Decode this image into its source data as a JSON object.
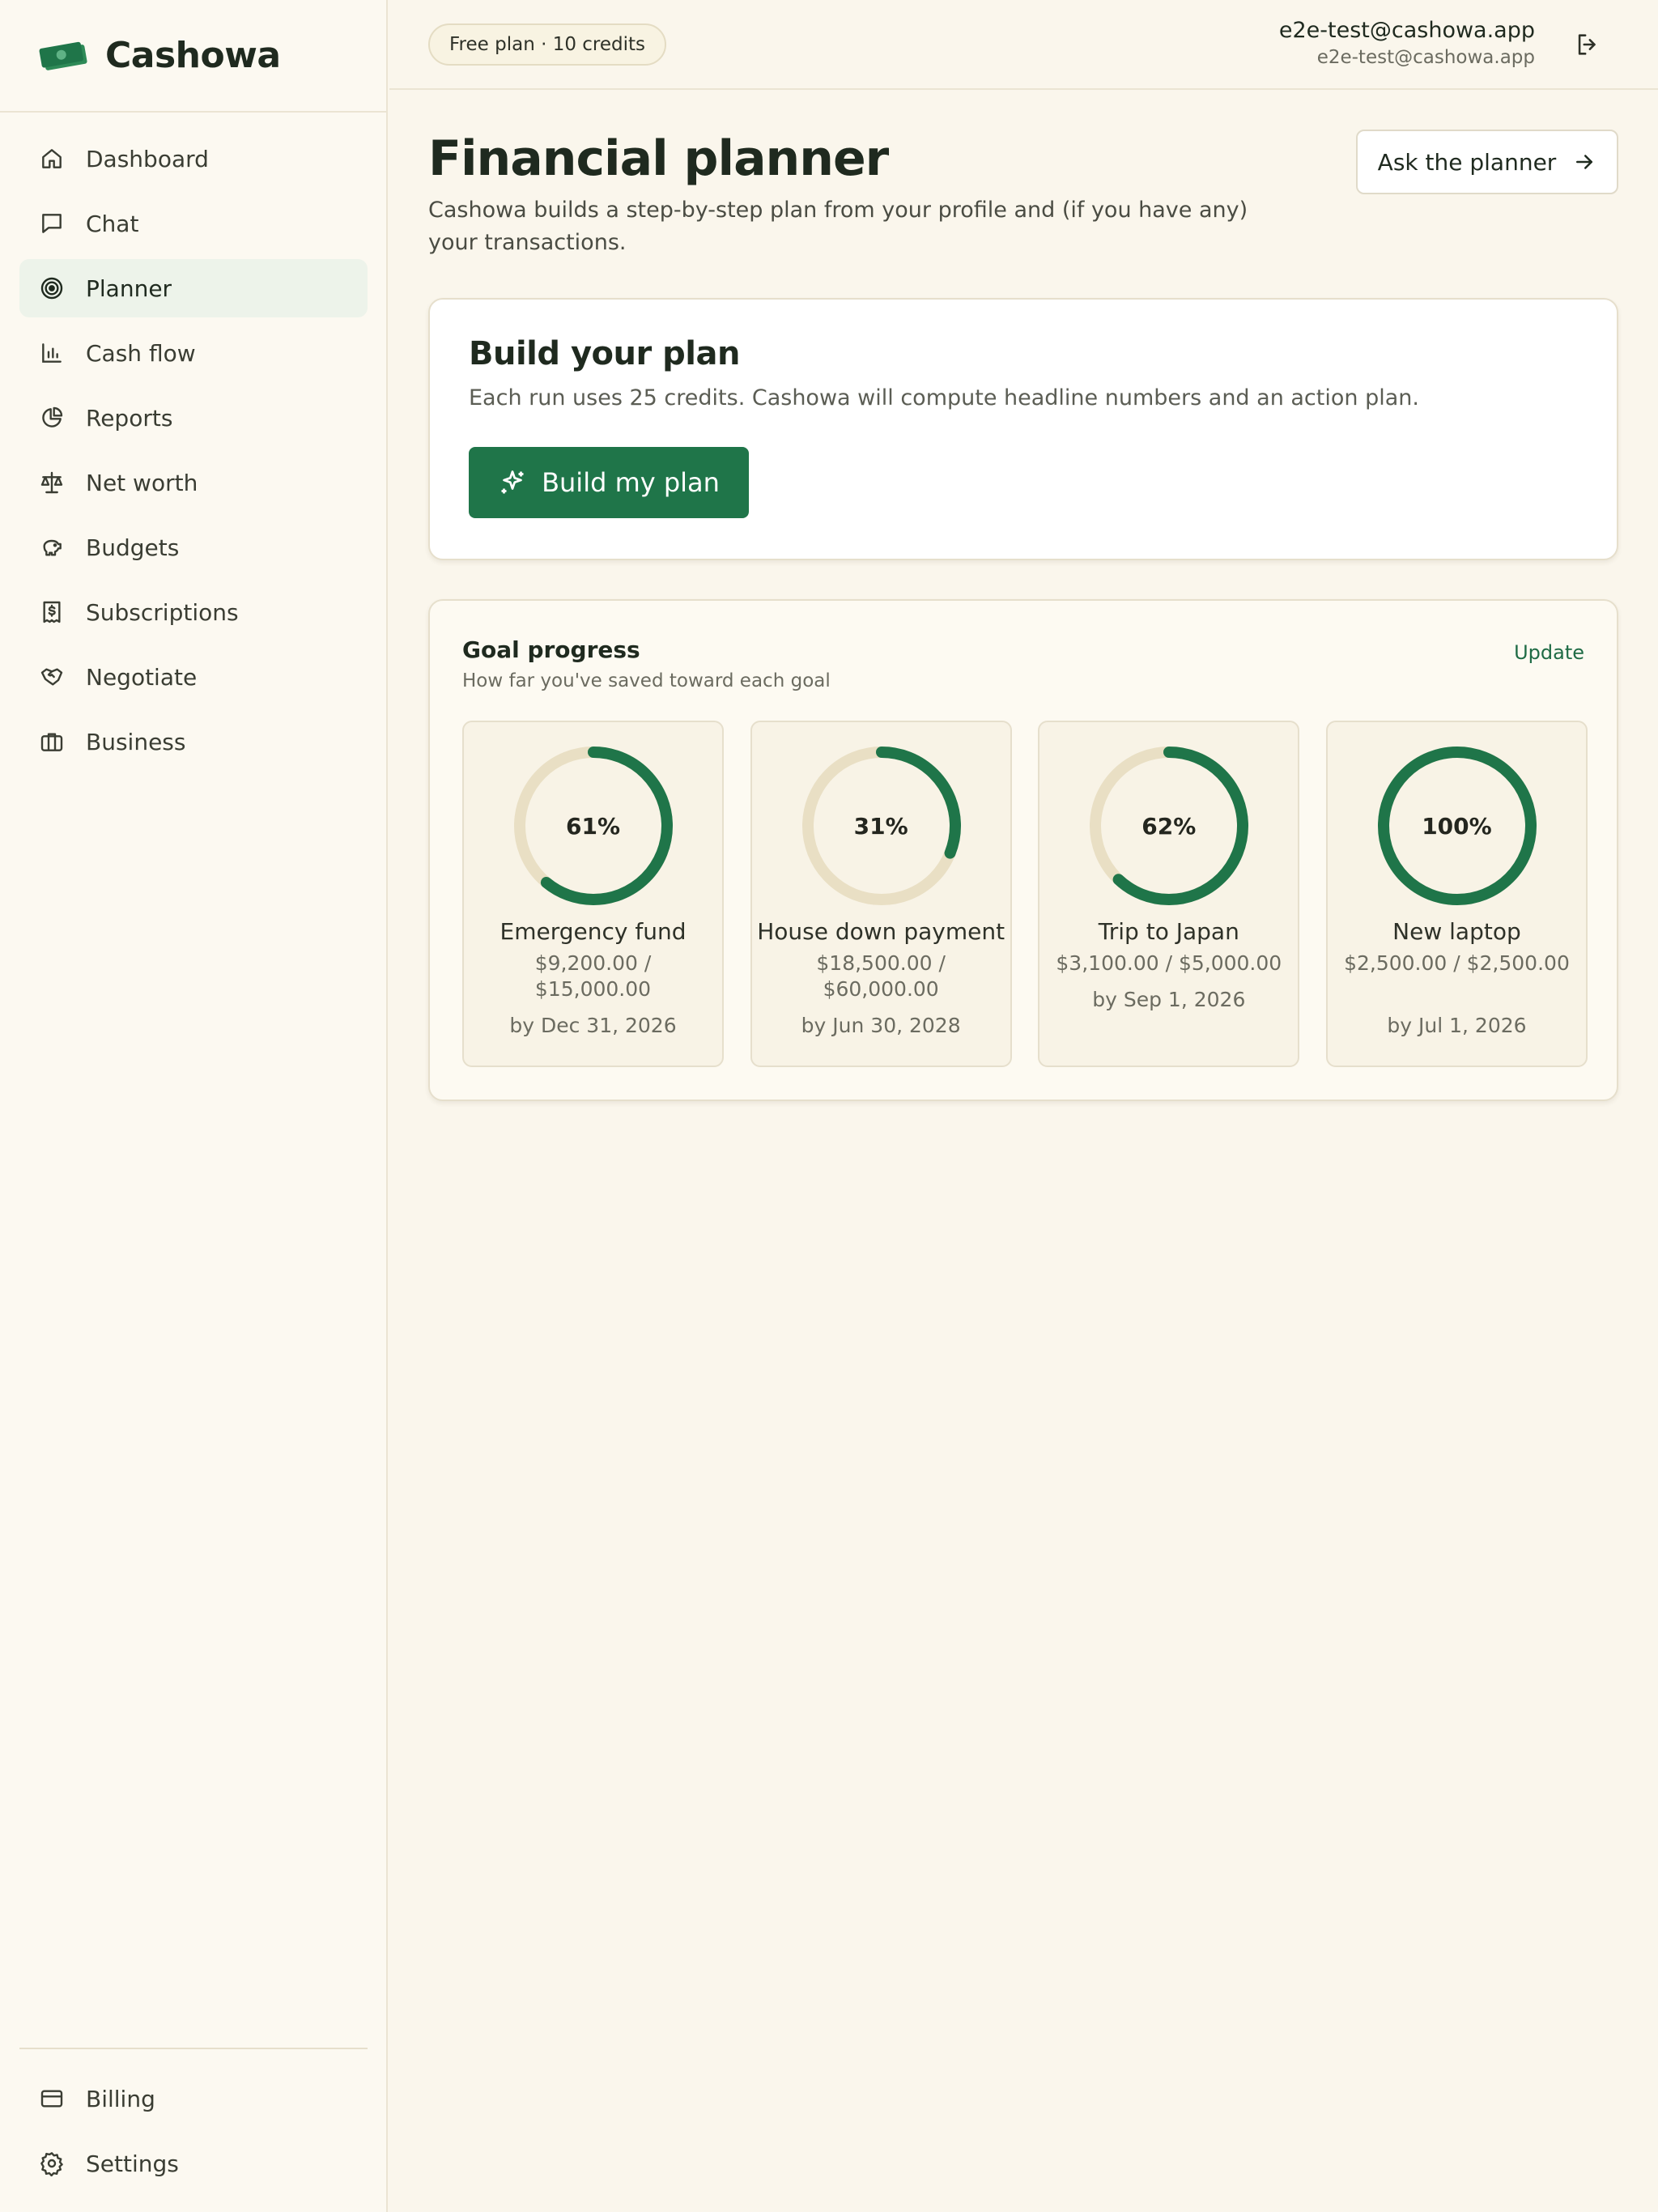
{
  "brand": {
    "name": "Cashowa"
  },
  "sidebar": {
    "items": [
      {
        "label": "Dashboard",
        "icon": "home-icon",
        "active": false
      },
      {
        "label": "Chat",
        "icon": "chat-icon",
        "active": false
      },
      {
        "label": "Planner",
        "icon": "target-icon",
        "active": true
      },
      {
        "label": "Cash flow",
        "icon": "bar-chart-icon",
        "active": false
      },
      {
        "label": "Reports",
        "icon": "pie-chart-icon",
        "active": false
      },
      {
        "label": "Net worth",
        "icon": "scale-icon",
        "active": false
      },
      {
        "label": "Budgets",
        "icon": "piggy-bank-icon",
        "active": false
      },
      {
        "label": "Subscriptions",
        "icon": "receipt-icon",
        "active": false
      },
      {
        "label": "Negotiate",
        "icon": "handshake-icon",
        "active": false
      },
      {
        "label": "Business",
        "icon": "briefcase-icon",
        "active": false
      }
    ],
    "bottom_items": [
      {
        "label": "Billing",
        "icon": "credit-card-icon"
      },
      {
        "label": "Settings",
        "icon": "gear-icon"
      }
    ]
  },
  "header": {
    "plan_badge": "Free plan · 10 credits",
    "user_email": "e2e-test@cashowa.app",
    "user_sub": "e2e-test@cashowa.app"
  },
  "main": {
    "title": "Financial planner",
    "description": "Cashowa builds a step-by-step plan from your profile and (if you have any) your transactions.",
    "ask_button": "Ask the planner",
    "build_card": {
      "title": "Build your plan",
      "description": "Each run uses 25 credits. Cashowa will compute headline numbers and an action plan.",
      "button": "Build my plan"
    },
    "goal_card": {
      "title": "Goal progress",
      "subtitle": "How far you've saved toward each goal",
      "update_link": "Update",
      "goals": [
        {
          "percent_label": "61%",
          "percent": 61,
          "name": "Emergency fund",
          "amount": "$9,200.00 / $15,000.00",
          "date": "by Dec 31, 2026"
        },
        {
          "percent_label": "31%",
          "percent": 31,
          "name": "House down payment",
          "amount": "$18,500.00 / $60,000.00",
          "date": "by Jun 30, 2028"
        },
        {
          "percent_label": "62%",
          "percent": 62,
          "name": "Trip to Japan",
          "amount": "$3,100.00 / $5,000.00",
          "date": "by Sep 1, 2026"
        },
        {
          "percent_label": "100%",
          "percent": 100,
          "name": "New laptop",
          "amount": "$2,500.00 / $2,500.00",
          "date": "by Jul 1, 2026"
        }
      ]
    }
  },
  "colors": {
    "accent": "#1f7549",
    "ring_track": "#e9dfc4",
    "ring_fill": "#1f7549",
    "active_nav_bg": "#edf3ea"
  }
}
